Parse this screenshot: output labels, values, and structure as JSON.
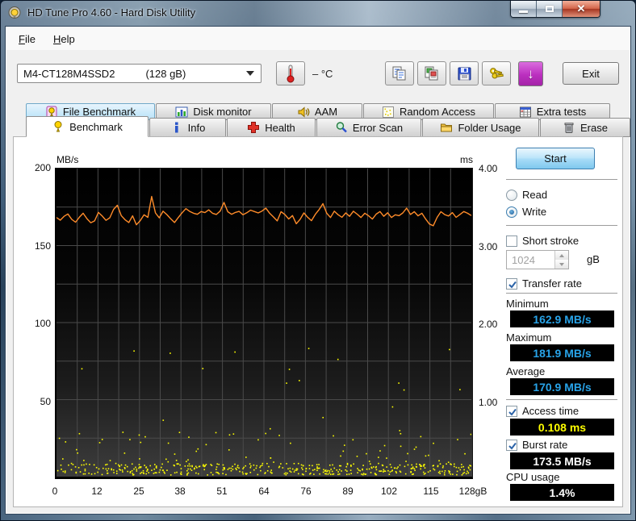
{
  "window": {
    "title": "HD Tune Pro 4.60 - Hard Disk Utility",
    "caption_buttons": [
      "minimize",
      "maximize",
      "close"
    ]
  },
  "menu": {
    "items": [
      "File",
      "Help"
    ]
  },
  "toolbar": {
    "drive_select": {
      "device": "M4-CT128M4SSD2",
      "capacity": "(128 gB)"
    },
    "temperature_display": "– °C",
    "buttons": [
      "copy-text",
      "copy-image",
      "save",
      "options",
      "update"
    ],
    "exit_label": "Exit"
  },
  "tabs": {
    "row1": [
      {
        "label": "File Benchmark"
      },
      {
        "label": "Disk monitor"
      },
      {
        "label": "AAM"
      },
      {
        "label": "Random Access"
      },
      {
        "label": "Extra tests"
      }
    ],
    "row2": [
      {
        "label": "Benchmark"
      },
      {
        "label": "Info"
      },
      {
        "label": "Health"
      },
      {
        "label": "Error Scan"
      },
      {
        "label": "Folder Usage"
      },
      {
        "label": "Erase"
      }
    ],
    "active": "Benchmark"
  },
  "panel": {
    "start_label": "Start",
    "read_label": "Read",
    "write_label": "Write",
    "read_selected": false,
    "write_selected": true,
    "short_stroke_label": "Short stroke",
    "short_stroke_checked": false,
    "short_stroke_value": "1024",
    "short_stroke_unit": "gB",
    "transfer_rate_label": "Transfer rate",
    "transfer_rate_checked": true,
    "minimum_label": "Minimum",
    "minimum_value": "162.9 MB/s",
    "maximum_label": "Maximum",
    "maximum_value": "181.9 MB/s",
    "average_label": "Average",
    "average_value": "170.9 MB/s",
    "access_time_label": "Access time",
    "access_time_checked": true,
    "access_time_value": "0.108 ms",
    "burst_rate_label": "Burst rate",
    "burst_rate_checked": true,
    "burst_rate_value": "173.5 MB/s",
    "cpu_usage_label": "CPU usage",
    "cpu_usage_value": "1.4%"
  },
  "chart_data": {
    "type": "line",
    "title": "Write benchmark: transfer rate (MB/s, left axis) and access time (ms, right axis) vs disk position (gB)",
    "left_axis": {
      "label": "MB/s",
      "ticks": [
        "200",
        "150",
        "100",
        "50"
      ],
      "min": 0,
      "max": 200
    },
    "right_axis": {
      "label": "ms",
      "ticks": [
        "4.00",
        "3.00",
        "2.00",
        "1.00"
      ],
      "min": 0,
      "max": 4
    },
    "x_axis": {
      "ticks": [
        "0",
        "12",
        "25",
        "38",
        "51",
        "64",
        "76",
        "89",
        "102",
        "115",
        "128gB"
      ],
      "min": 0,
      "max": 128
    },
    "grid": {
      "color": "#4a4a4a",
      "v_divisions": 20,
      "h_step_left": 25
    },
    "series": [
      {
        "name": "Transfer rate",
        "axis": "left",
        "kind": "line",
        "color": "#ff8c2a",
        "summary": {
          "minimum": 162.9,
          "maximum": 181.9,
          "average": 170.9
        },
        "values": [
          168.2,
          166.5,
          169.0,
          170.5,
          167.0,
          165.2,
          168.4,
          171.0,
          167.5,
          164.8,
          166.0,
          171.5,
          169.2,
          166.4,
          168.0,
          173.5,
          176.2,
          169.5,
          166.8,
          165.0,
          169.3,
          163.5,
          166.2,
          170.0,
          168.3,
          181.9,
          171.2,
          168.0,
          172.3,
          170.1,
          167.4,
          165.0,
          168.2,
          171.3,
          174.0,
          172.2,
          171.0,
          170.3,
          172.1,
          171.4,
          173.2,
          171.0,
          170.2,
          172.4,
          178.0,
          172.0,
          170.3,
          171.5,
          172.2,
          170.0,
          171.3,
          173.0,
          172.1,
          171.2,
          172.4,
          174.3,
          171.0,
          168.6,
          166.0,
          172.0,
          170.2,
          167.3,
          169.5,
          164.2,
          167.0,
          171.2,
          168.4,
          166.2,
          170.3,
          173.4,
          177.2,
          171.0,
          168.2,
          172.3,
          170.0,
          168.4,
          171.2,
          169.0,
          172.3,
          170.4,
          168.2,
          171.0,
          169.3,
          167.2,
          170.4,
          172.1,
          169.0,
          171.3,
          168.2,
          170.0,
          169.4,
          171.2,
          174.3,
          170.2,
          172.0,
          169.3,
          171.0,
          167.2,
          164.0,
          162.9,
          168.3,
          172.0,
          170.1,
          169.2,
          171.4,
          168.3,
          170.2,
          172.1,
          171.0,
          169.5
        ]
      },
      {
        "name": "Access time",
        "axis": "right",
        "kind": "scatter",
        "color": "#ffff00",
        "summary": {
          "reported": 0.108
        },
        "distribution": {
          "seed": 9,
          "count": 520,
          "bands": [
            {
              "weight": 0.8,
              "min_ms": 0.03,
              "max_ms": 0.18
            },
            {
              "weight": 0.16,
              "min_ms": 0.18,
              "max_ms": 0.6
            },
            {
              "weight": 0.04,
              "min_ms": 0.6,
              "max_ms": 1.7
            }
          ]
        }
      }
    ]
  },
  "colors": {
    "line_orange": "#ff8c2a",
    "scatter_yellow": "#ffff00",
    "value_blue": "#28a3e8",
    "value_yellow": "#ffff00",
    "value_white": "#ffffff",
    "plot_grid": "#4a4a4a",
    "update_button": "#bb2fbf",
    "close_button": "#c0402c"
  }
}
